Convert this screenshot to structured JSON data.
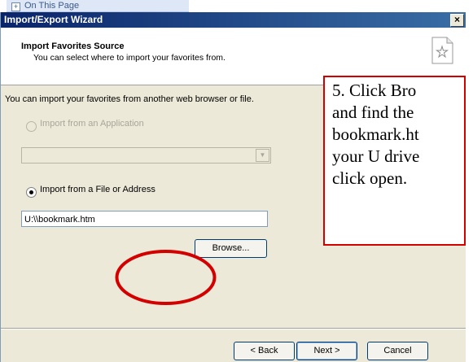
{
  "background_page": {
    "on_this_page_label": "On This Page"
  },
  "wizard": {
    "title": "Import/Export Wizard",
    "close_glyph": "×",
    "header_title": "Import Favorites Source",
    "header_subtitle": "You can select where to import your favorites from.",
    "instruction": "You can import your favorites from another web browser or file.",
    "option_application_label": "Import from an Application",
    "option_application_selected": false,
    "option_application_enabled": false,
    "application_select_value": "",
    "option_file_label": "Import from a File or Address",
    "option_file_selected": true,
    "file_path_value": "U:\\\\bookmark.htm",
    "browse_label": "Browse...",
    "back_label": "< Back",
    "next_label": "Next >",
    "cancel_label": "Cancel"
  },
  "annotation": {
    "callout_lines": [
      "5.  Click Bro",
      "and find the",
      "bookmark.ht",
      "your U drive",
      "click open."
    ],
    "accent_color": "#d40000"
  },
  "icons": {
    "expand": "plus-box-icon",
    "header": "favorites-star-icon",
    "close": "close-icon",
    "dropdown": "chevron-down-icon"
  }
}
